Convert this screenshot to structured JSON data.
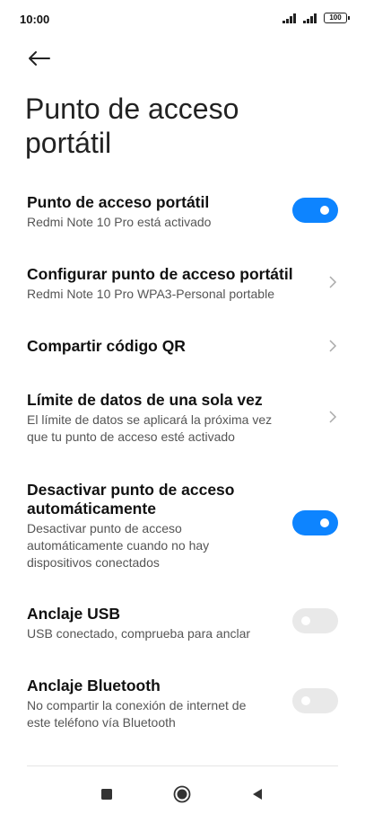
{
  "status_bar": {
    "time": "10:00",
    "battery": "100"
  },
  "header": {
    "back_icon": "arrow-left-icon",
    "title": "Punto de acceso portátil"
  },
  "settings": {
    "hotspot": {
      "title": "Punto de acceso portátil",
      "subtitle": "Redmi Note 10 Pro está activado",
      "enabled": true
    },
    "configure": {
      "title": "Configurar punto de acceso portátil",
      "subtitle": "Redmi Note 10 Pro WPA3-Personal portable"
    },
    "share_qr": {
      "title": "Compartir código QR"
    },
    "data_limit": {
      "title": "Límite de datos de una sola vez",
      "subtitle_line1": "El límite de datos se aplicará la próxima vez",
      "subtitle_line2": "que tu punto de acceso esté activado"
    },
    "auto_off": {
      "title_line1": "Desactivar punto de acceso",
      "title_line2": "automáticamente",
      "subtitle_line1": "Desactivar punto de acceso",
      "subtitle_line2": "automáticamente cuando no hay",
      "subtitle_line3": "dispositivos conectados",
      "enabled": true
    },
    "usb": {
      "title": "Anclaje USB",
      "subtitle": "USB conectado, comprueba para anclar",
      "enabled": false
    },
    "bluetooth": {
      "title": "Anclaje Bluetooth",
      "subtitle_line1": "No compartir la conexión de internet de",
      "subtitle_line2": "este teléfono vía Bluetooth",
      "enabled": false
    }
  },
  "colors": {
    "accent": "#0d84ff",
    "toggle_off": "#e9e9e9"
  },
  "nav": {
    "recents_icon": "square-icon",
    "home_icon": "circle-home-icon",
    "back_icon": "triangle-back-icon"
  }
}
